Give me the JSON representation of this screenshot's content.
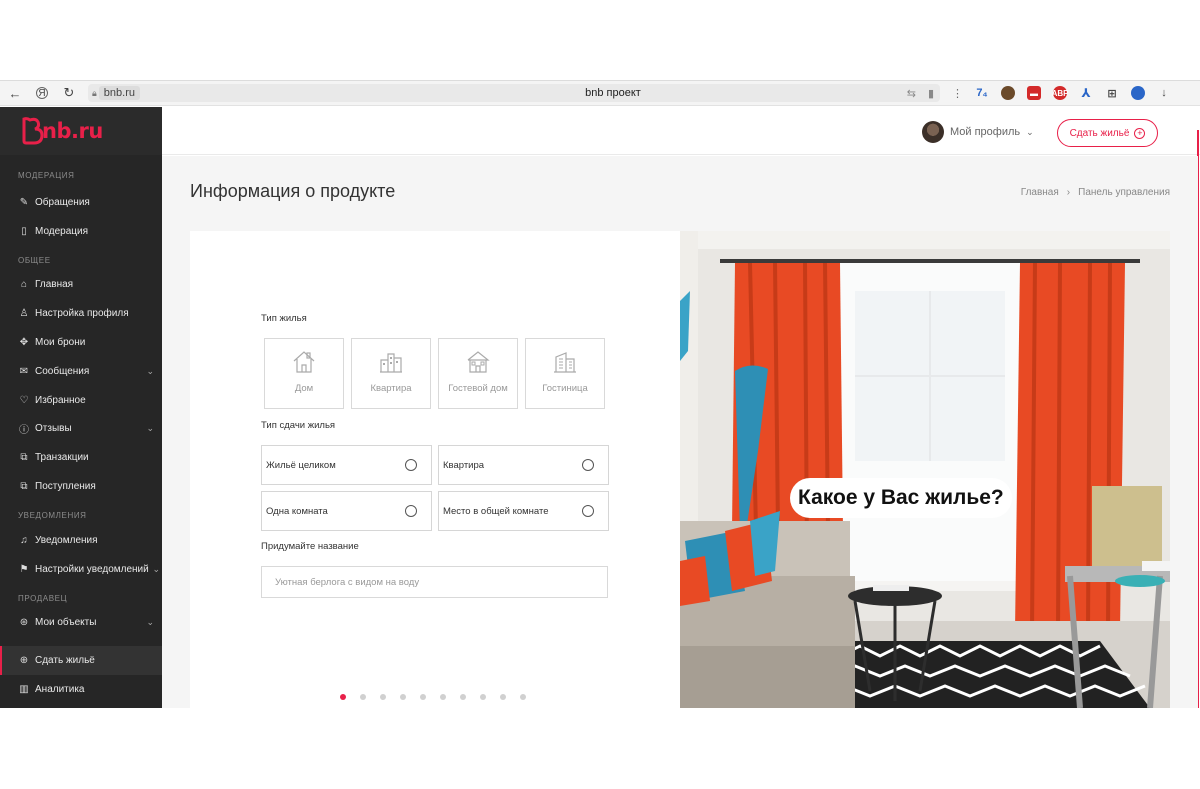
{
  "browser": {
    "url_domain": "bnb.ru",
    "tab_title": "bnb проект"
  },
  "logo": {
    "text_main": "bnb",
    "text_suffix": ".ru"
  },
  "sidebar": {
    "sections": [
      {
        "title": "МОДЕРАЦИЯ",
        "items": [
          {
            "label": "Обращения",
            "icon": "edit-icon"
          },
          {
            "label": "Модерация",
            "icon": "book-icon"
          }
        ]
      },
      {
        "title": "ОБЩЕЕ",
        "items": [
          {
            "label": "Главная",
            "icon": "home-icon"
          },
          {
            "label": "Настройка профиля",
            "icon": "user-icon"
          },
          {
            "label": "Мои брони",
            "icon": "compass-icon"
          },
          {
            "label": "Сообщения",
            "icon": "envelope-icon",
            "chevron": true
          },
          {
            "label": "Избранное",
            "icon": "heart-icon"
          },
          {
            "label": "Отзывы",
            "icon": "info-icon",
            "chevron": true
          },
          {
            "label": "Транзакции",
            "icon": "copy-icon"
          },
          {
            "label": "Поступления",
            "icon": "copy-icon"
          }
        ]
      },
      {
        "title": "УВЕДОМЛЕНИЯ",
        "items": [
          {
            "label": "Уведомления",
            "icon": "bell-icon"
          },
          {
            "label": "Настройки уведомлений",
            "icon": "sign-icon",
            "chevron": true
          }
        ]
      },
      {
        "title": "ПРОДАВЕЦ",
        "items": [
          {
            "label": "Мои объекты",
            "icon": "pin-icon",
            "chevron": true
          },
          {
            "label": "Сдать жильё",
            "icon": "plus-circle-icon",
            "active": true
          },
          {
            "label": "Аналитика",
            "icon": "chart-icon"
          }
        ]
      }
    ]
  },
  "header": {
    "profile_label": "Мой профиль",
    "cta_label": "Сдать жильё"
  },
  "page": {
    "title": "Информация о продукте",
    "breadcrumb": [
      "Главная",
      "Панель управления"
    ]
  },
  "form": {
    "housing_type_label": "Тип жилья",
    "housing_types": [
      "Дом",
      "Квартира",
      "Гостевой дом",
      "Гостиница"
    ],
    "rent_type_label": "Тип сдачи жилья",
    "rent_types": [
      "Жильё целиком",
      "Квартира",
      "Одна комната",
      "Место в общей комнате"
    ],
    "name_label": "Придумайте название",
    "name_placeholder": "Уютная берлога с видом на воду",
    "steps_total": 10,
    "current_step": 1
  },
  "photo": {
    "question": "Какое у Вас жилье?"
  },
  "colors": {
    "accent": "#e82049",
    "sidebar_bg": "#262626"
  }
}
